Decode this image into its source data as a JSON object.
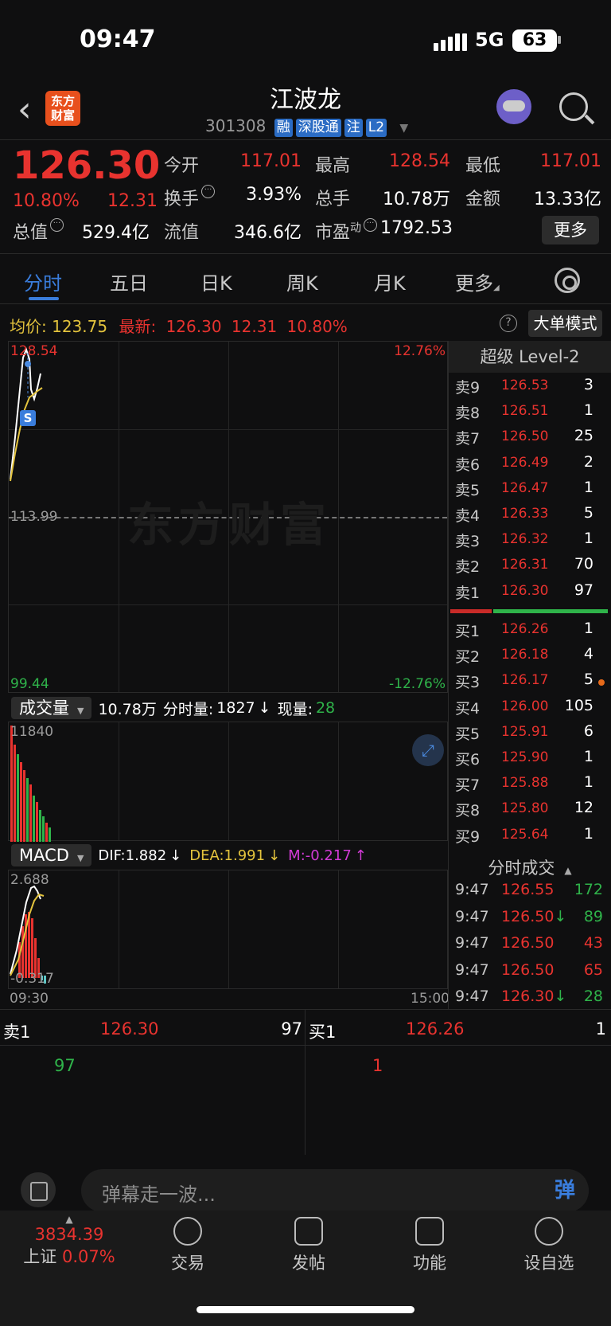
{
  "status": {
    "time": "09:47",
    "network": "5G",
    "battery": "63"
  },
  "header": {
    "back_icon": "chevron-left-icon",
    "logo_text_1": "东方",
    "logo_text_2": "财富",
    "stock_name": "江波龙",
    "stock_code": "301308",
    "tags": [
      "融",
      "深股通",
      "注",
      "L2"
    ]
  },
  "quote": {
    "price": "126.30",
    "change_pct": "10.80%",
    "change_abs": "12.31",
    "today_open_label": "今开",
    "today_open": "117.01",
    "high_label": "最高",
    "high": "128.54",
    "low_label": "最低",
    "low": "117.01",
    "turnover_label": "换手",
    "turnover": "3.93%",
    "volume_label": "总手",
    "volume": "10.78万",
    "amount_label": "金额",
    "amount": "13.33亿",
    "total_mv_label": "总值",
    "total_mv": "529.4亿",
    "float_mv_label": "流值",
    "float_mv": "346.6亿",
    "pe_label": "市盈",
    "pe_sup": "动",
    "pe": "1792.53",
    "more_label": "更多"
  },
  "tabs": [
    "分时",
    "五日",
    "日K",
    "周K",
    "月K",
    "更多"
  ],
  "avg_row": {
    "avg_label": "均价:",
    "avg": "123.75",
    "latest_label": "最新:",
    "latest": "126.30",
    "latest_chg": "12.31",
    "latest_pct": "10.80%",
    "big_order_label": "大单模式"
  },
  "chart": {
    "y_top": "128.54",
    "y_mid": "113.99",
    "y_bottom": "99.44",
    "pct_top": "12.76%",
    "pct_bottom": "-12.76%",
    "watermark": "东方财富",
    "marker": "S"
  },
  "volume": {
    "pill_label": "成交量",
    "total": "10.78万",
    "minute_label": "分时量:",
    "minute": "1827",
    "current_label": "现量:",
    "current": "28",
    "y_max": "11840"
  },
  "macd": {
    "pill_label": "MACD",
    "dif": "DIF:1.882",
    "dea": "DEA:1.991",
    "m": "M:-0.217",
    "y_max": "2.688",
    "y_min": "-0.317",
    "time_start": "09:30",
    "time_end": "15:00"
  },
  "orderbook": {
    "title": "超级 Level-2",
    "asks": [
      {
        "label": "卖9",
        "price": "126.53",
        "vol": "3"
      },
      {
        "label": "卖8",
        "price": "126.51",
        "vol": "1"
      },
      {
        "label": "卖7",
        "price": "126.50",
        "vol": "25"
      },
      {
        "label": "卖6",
        "price": "126.49",
        "vol": "2"
      },
      {
        "label": "卖5",
        "price": "126.47",
        "vol": "1"
      },
      {
        "label": "卖4",
        "price": "126.33",
        "vol": "5"
      },
      {
        "label": "卖3",
        "price": "126.32",
        "vol": "1"
      },
      {
        "label": "卖2",
        "price": "126.31",
        "vol": "70"
      },
      {
        "label": "卖1",
        "price": "126.30",
        "vol": "97"
      }
    ],
    "bids": [
      {
        "label": "买1",
        "price": "126.26",
        "vol": "1"
      },
      {
        "label": "买2",
        "price": "126.18",
        "vol": "4"
      },
      {
        "label": "买3",
        "price": "126.17",
        "vol": "5"
      },
      {
        "label": "买4",
        "price": "126.00",
        "vol": "105"
      },
      {
        "label": "买5",
        "price": "125.91",
        "vol": "6"
      },
      {
        "label": "买6",
        "price": "125.90",
        "vol": "1"
      },
      {
        "label": "买7",
        "price": "125.88",
        "vol": "1"
      },
      {
        "label": "买8",
        "price": "125.80",
        "vol": "12"
      },
      {
        "label": "买9",
        "price": "125.64",
        "vol": "1"
      }
    ]
  },
  "ticks": {
    "title": "分时成交",
    "rows": [
      {
        "time": "9:47",
        "price": "126.55",
        "arrow": "",
        "vol": "172",
        "color": "#2fb34a"
      },
      {
        "time": "9:47",
        "price": "126.50",
        "arrow": "↓",
        "vol": "89",
        "color": "#2fb34a"
      },
      {
        "time": "9:47",
        "price": "126.50",
        "arrow": "",
        "vol": "43",
        "color": "#e8332f"
      },
      {
        "time": "9:47",
        "price": "126.50",
        "arrow": "",
        "vol": "65",
        "color": "#e8332f"
      },
      {
        "time": "9:47",
        "price": "126.30",
        "arrow": "↓",
        "vol": "28",
        "color": "#2fb34a"
      }
    ]
  },
  "bidask": {
    "sell_label": "卖1",
    "sell_price": "126.30",
    "sell_vol": "97",
    "sell_detail": "97",
    "buy_label": "买1",
    "buy_price": "126.26",
    "buy_vol": "1",
    "buy_detail": "1"
  },
  "comment": {
    "placeholder": "弹幕走一波...",
    "danmu_btn": "弹"
  },
  "nav": {
    "index_value": "3834.39",
    "index_name": "上证",
    "index_pct": "0.07%",
    "items": [
      "交易",
      "发帖",
      "功能",
      "设自选"
    ]
  },
  "colors": {
    "up": "#e8332f",
    "down": "#2fb34a",
    "accent": "#3a7ddc",
    "avg": "#e3c33d"
  }
}
